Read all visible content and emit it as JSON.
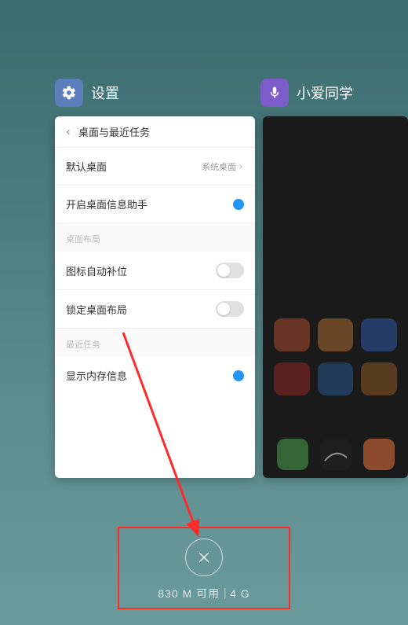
{
  "tasks": [
    {
      "icon": "gear-icon",
      "title": "设置"
    },
    {
      "icon": "mic-icon",
      "title": "小爱同学"
    }
  ],
  "settings_panel": {
    "header": "桌面与最近任务",
    "default_home": {
      "label": "默认桌面",
      "value": "系统桌面"
    },
    "info_assistant": {
      "label": "开启桌面信息助手",
      "on": true
    },
    "section_layout": "桌面布局",
    "auto_fill": {
      "label": "图标自动补位",
      "on": false
    },
    "lock_layout": {
      "label": "锁定桌面布局",
      "on": false
    },
    "section_recent": "最近任务",
    "show_memory": {
      "label": "显示内存信息",
      "on": true
    }
  },
  "memory": {
    "available": "830 M 可用",
    "total": "4 G"
  },
  "annotation": {
    "color": "#ff2a2a"
  }
}
